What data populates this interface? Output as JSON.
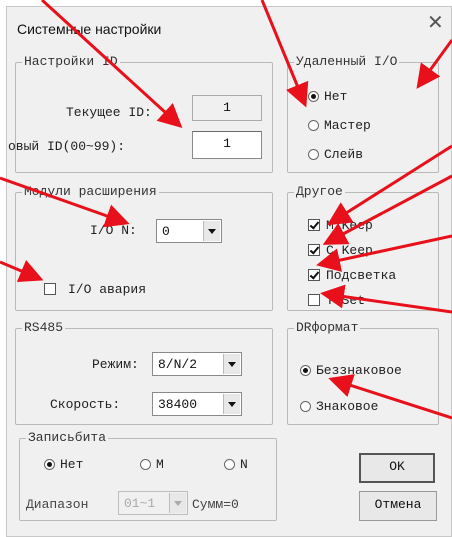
{
  "window": {
    "title": "Системные настройки",
    "close_glyph": "✕"
  },
  "id_settings": {
    "legend": "Настройки ID",
    "current_label": "Текущее ID:",
    "current_value": "1",
    "new_label": "овый ID(00~99):",
    "new_value": "1"
  },
  "remote_io": {
    "legend": "Удаленный I/O",
    "options": [
      {
        "label": "Нет",
        "selected": true
      },
      {
        "label": "Мастер",
        "selected": false
      },
      {
        "label": "Слейв",
        "selected": false
      }
    ]
  },
  "expansion": {
    "legend": "Модули расширения",
    "io_label": "I/O N:",
    "io_value": "0",
    "alarm_label": "I/O авария",
    "alarm_checked": false
  },
  "other": {
    "legend": "Другое",
    "items": [
      {
        "label": "M Keep",
        "checked": true
      },
      {
        "label": "C Keep",
        "checked": true
      },
      {
        "label": "Подсветка",
        "checked": true
      },
      {
        "label": "T Set",
        "checked": false
      }
    ]
  },
  "rs485": {
    "legend": "RS485",
    "mode_label": "Режим:",
    "mode_value": "8/N/2",
    "speed_label": "Скорость:",
    "speed_value": "38400"
  },
  "dr_format": {
    "legend": "DRформат",
    "options": [
      {
        "label": "Беззнаковое",
        "selected": true
      },
      {
        "label": "Знаковое",
        "selected": false
      }
    ]
  },
  "bit_write": {
    "legend": "Записьбита",
    "options": [
      {
        "label": "Нет",
        "selected": true
      },
      {
        "label": "M",
        "selected": false
      },
      {
        "label": "N",
        "selected": false
      }
    ],
    "range_label": "Диапазон",
    "range_value": "01~1",
    "sum_label": "Сумм=0"
  },
  "buttons": {
    "ok": "OK",
    "cancel": "Отмена"
  },
  "colors": {
    "annotation_arrow": "#e8101a"
  }
}
